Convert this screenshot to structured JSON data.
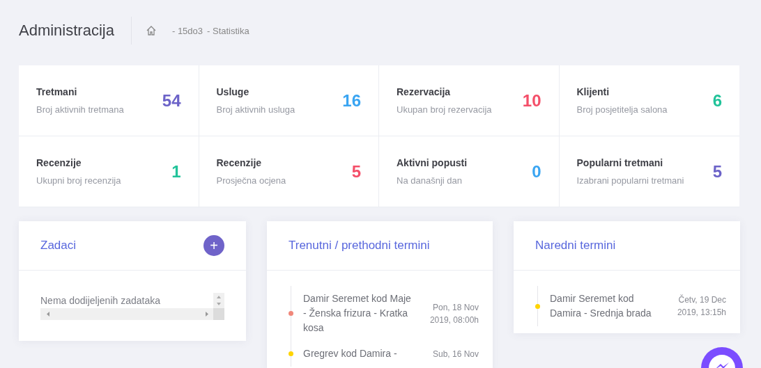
{
  "header": {
    "title": "Administracija",
    "breadcrumb": [
      "- 15do3",
      "- Statistika"
    ]
  },
  "stats": [
    {
      "title": "Tretmani",
      "subtitle": "Broj aktivnih tretmana",
      "value": "54",
      "color": "#6c63c8"
    },
    {
      "title": "Usluge",
      "subtitle": "Broj aktivnih usluga",
      "value": "16",
      "color": "#3aa5f2"
    },
    {
      "title": "Rezervacija",
      "subtitle": "Ukupan broj rezervacija",
      "value": "10",
      "color": "#f44f69"
    },
    {
      "title": "Klijenti",
      "subtitle": "Broj posjetitelja salona",
      "value": "6",
      "color": "#22c39a"
    },
    {
      "title": "Recenzije",
      "subtitle": "Ukupni broj recenzija",
      "value": "1",
      "color": "#22c39a"
    },
    {
      "title": "Recenzije",
      "subtitle": "Prosječna ocjena",
      "value": "5",
      "color": "#f44f69"
    },
    {
      "title": "Aktivni popusti",
      "subtitle": "Na današnji dan",
      "value": "0",
      "color": "#3aa5f2"
    },
    {
      "title": "Popularni tretmani",
      "subtitle": "Izabrani popularni tretmani",
      "value": "5",
      "color": "#6c63c8"
    }
  ],
  "tasks": {
    "title": "Zadaci",
    "add_button": "+",
    "empty": "Nema dodijeljenih zadataka"
  },
  "current": {
    "title": "Trenutni / prethodni termini",
    "items": [
      {
        "text": "Damir Seremet kod Maje - Ženska frizura - Kratka kosa",
        "date": "Pon, 18 Nov 2019, 08:00h",
        "color": "#f0877a"
      },
      {
        "text": "Gregrev kod Damira -",
        "date": "Sub, 16 Nov",
        "color": "#ffd400"
      }
    ]
  },
  "upcoming": {
    "title": "Naredni termini",
    "items": [
      {
        "text": "Damir Seremet kod Damira - Srednja brada",
        "date": "Četv, 19 Dec 2019, 13:15h",
        "color": "#ffd400"
      }
    ]
  }
}
